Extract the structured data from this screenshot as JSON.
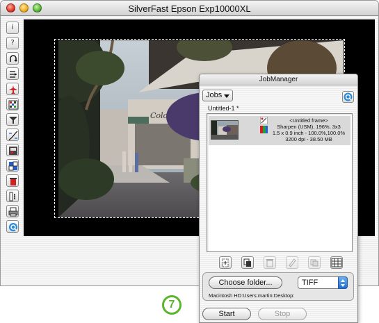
{
  "window": {
    "title": "SilverFast Epson Exp10000XL"
  },
  "toolbar": {
    "info_glyph": "i",
    "help_glyph": "?"
  },
  "step_badge": "7",
  "job_manager": {
    "title": "JobManager",
    "jobs_menu_label": "Jobs",
    "document_title": "Untitled-1 *",
    "jobs": [
      {
        "frame_name": "<Untitled frame>",
        "filter": "Sharpen (USM), 196%, 3x3",
        "size": "1.5 x 0.9 inch - 100.0%,100.0%",
        "resolution": "3200 dpi - 38.50 MB"
      }
    ],
    "choose_folder_label": "Choose folder...",
    "format_value": "TIFF",
    "folder_path": "Macintosh HD:Users:martin:Desktop:",
    "start_label": "Start",
    "stop_label": "Stop"
  },
  "colors": {
    "accent_green": "#5ab52c",
    "preview_background": "#000000",
    "stepper_blue": "#1e6ed0"
  },
  "icons": {
    "toolbar": [
      "info-icon",
      "help-icon",
      "undo-icon",
      "densitometer-icon",
      "airplane-icon",
      "grid-icon",
      "filter-icon",
      "gradation-icon",
      "color-icon",
      "selective-color-icon",
      "trash-icon",
      "expert-icon",
      "print-icon",
      "silverfast-icon"
    ],
    "job_toolbar": [
      "new-job-icon",
      "duplicate-icon",
      "trash-icon",
      "edit-icon",
      "copy-icon",
      "batch-icon"
    ]
  }
}
